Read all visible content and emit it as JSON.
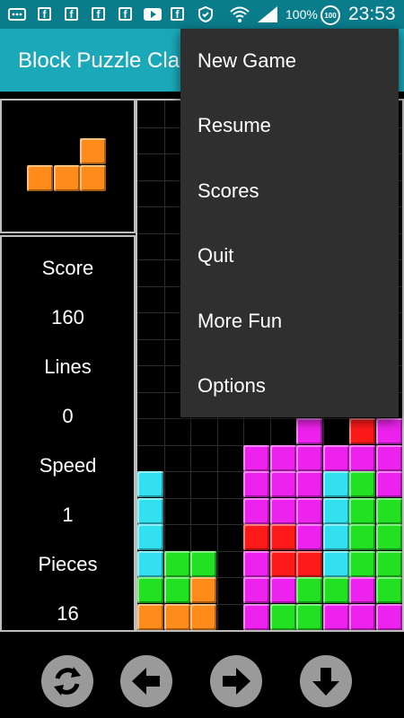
{
  "status_bar": {
    "battery_text": "100%",
    "battery_badge": "100",
    "clock": "23:53",
    "icons": [
      "messages-icon",
      "facebook-icon",
      "facebook-icon",
      "facebook-icon",
      "facebook-icon",
      "youtube-icon",
      "facebook-icon",
      "shield-icon",
      "wifi-icon",
      "signal-icon",
      "battery-icon"
    ]
  },
  "app_bar": {
    "title": "Block Puzzle Classic"
  },
  "stats": {
    "score_label": "Score",
    "score_value": "160",
    "lines_label": "Lines",
    "lines_value": "0",
    "speed_label": "Speed",
    "speed_value": "1",
    "pieces_label": "Pieces",
    "pieces_value": "16"
  },
  "menu": {
    "items": [
      {
        "label": "New Game"
      },
      {
        "label": "Resume"
      },
      {
        "label": "Scores"
      },
      {
        "label": "Quit"
      },
      {
        "label": "More Fun"
      },
      {
        "label": "Options"
      }
    ]
  },
  "controls": [
    "rotate-icon",
    "arrow-left-icon",
    "arrow-right-icon",
    "arrow-down-icon"
  ],
  "colors": {
    "status_bar": "#0a7d8c",
    "app_bar": "#1ba9ba",
    "menu_bg": "#2f2f2f",
    "orange": "#ff8c1a",
    "cyan": "#33e0f0",
    "green": "#22e022",
    "magenta": "#ee22ee",
    "red": "#ff1a1a"
  },
  "next_piece": {
    "color": "orange",
    "cells": [
      [
        2,
        0
      ],
      [
        0,
        1
      ],
      [
        1,
        1
      ],
      [
        2,
        1
      ]
    ]
  },
  "board": {
    "cols": 10,
    "rows": 20,
    "cells": [
      {
        "c": 6,
        "r": 12,
        "color": "magenta"
      },
      {
        "c": 8,
        "r": 12,
        "color": "red"
      },
      {
        "c": 9,
        "r": 12,
        "color": "magenta"
      },
      {
        "c": 4,
        "r": 13,
        "color": "magenta"
      },
      {
        "c": 5,
        "r": 13,
        "color": "magenta"
      },
      {
        "c": 6,
        "r": 13,
        "color": "magenta"
      },
      {
        "c": 7,
        "r": 13,
        "color": "magenta"
      },
      {
        "c": 8,
        "r": 13,
        "color": "magenta"
      },
      {
        "c": 9,
        "r": 13,
        "color": "magenta"
      },
      {
        "c": 0,
        "r": 14,
        "color": "cyan"
      },
      {
        "c": 4,
        "r": 14,
        "color": "magenta"
      },
      {
        "c": 5,
        "r": 14,
        "color": "magenta"
      },
      {
        "c": 6,
        "r": 14,
        "color": "magenta"
      },
      {
        "c": 7,
        "r": 14,
        "color": "cyan"
      },
      {
        "c": 8,
        "r": 14,
        "color": "green"
      },
      {
        "c": 9,
        "r": 14,
        "color": "magenta"
      },
      {
        "c": 0,
        "r": 15,
        "color": "cyan"
      },
      {
        "c": 4,
        "r": 15,
        "color": "magenta"
      },
      {
        "c": 5,
        "r": 15,
        "color": "magenta"
      },
      {
        "c": 6,
        "r": 15,
        "color": "magenta"
      },
      {
        "c": 7,
        "r": 15,
        "color": "cyan"
      },
      {
        "c": 8,
        "r": 15,
        "color": "green"
      },
      {
        "c": 9,
        "r": 15,
        "color": "green"
      },
      {
        "c": 0,
        "r": 16,
        "color": "cyan"
      },
      {
        "c": 4,
        "r": 16,
        "color": "red"
      },
      {
        "c": 5,
        "r": 16,
        "color": "red"
      },
      {
        "c": 6,
        "r": 16,
        "color": "magenta"
      },
      {
        "c": 7,
        "r": 16,
        "color": "cyan"
      },
      {
        "c": 8,
        "r": 16,
        "color": "green"
      },
      {
        "c": 9,
        "r": 16,
        "color": "green"
      },
      {
        "c": 0,
        "r": 17,
        "color": "cyan"
      },
      {
        "c": 1,
        "r": 17,
        "color": "green"
      },
      {
        "c": 2,
        "r": 17,
        "color": "green"
      },
      {
        "c": 4,
        "r": 17,
        "color": "magenta"
      },
      {
        "c": 5,
        "r": 17,
        "color": "red"
      },
      {
        "c": 6,
        "r": 17,
        "color": "red"
      },
      {
        "c": 7,
        "r": 17,
        "color": "cyan"
      },
      {
        "c": 8,
        "r": 17,
        "color": "green"
      },
      {
        "c": 9,
        "r": 17,
        "color": "green"
      },
      {
        "c": 0,
        "r": 18,
        "color": "green"
      },
      {
        "c": 1,
        "r": 18,
        "color": "green"
      },
      {
        "c": 2,
        "r": 18,
        "color": "orange"
      },
      {
        "c": 4,
        "r": 18,
        "color": "magenta"
      },
      {
        "c": 5,
        "r": 18,
        "color": "magenta"
      },
      {
        "c": 6,
        "r": 18,
        "color": "green"
      },
      {
        "c": 7,
        "r": 18,
        "color": "green"
      },
      {
        "c": 8,
        "r": 18,
        "color": "magenta"
      },
      {
        "c": 9,
        "r": 18,
        "color": "green"
      },
      {
        "c": 0,
        "r": 19,
        "color": "orange"
      },
      {
        "c": 1,
        "r": 19,
        "color": "orange"
      },
      {
        "c": 2,
        "r": 19,
        "color": "orange"
      },
      {
        "c": 4,
        "r": 19,
        "color": "magenta"
      },
      {
        "c": 5,
        "r": 19,
        "color": "green"
      },
      {
        "c": 6,
        "r": 19,
        "color": "green"
      },
      {
        "c": 7,
        "r": 19,
        "color": "magenta"
      },
      {
        "c": 8,
        "r": 19,
        "color": "magenta"
      },
      {
        "c": 9,
        "r": 19,
        "color": "magenta"
      }
    ]
  }
}
